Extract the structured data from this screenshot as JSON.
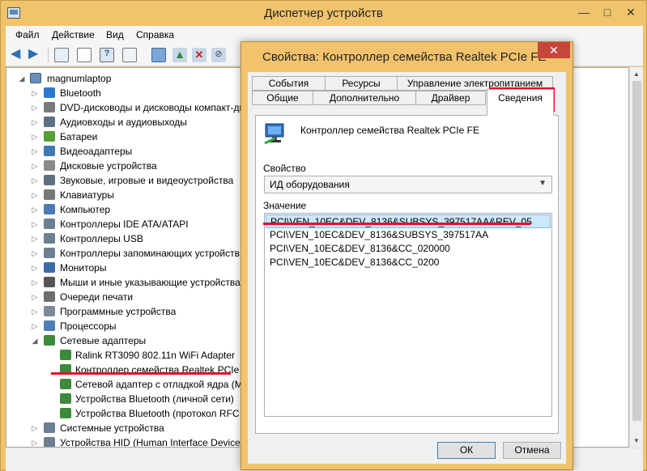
{
  "main": {
    "title": "Диспетчер устройств",
    "win_min": "—",
    "win_max": "□",
    "win_close": "✕"
  },
  "menu": [
    "Файл",
    "Действие",
    "Вид",
    "Справка"
  ],
  "tree": {
    "root": "magnumlaptop",
    "items": [
      "Bluetooth",
      "DVD-дисководы и дисководы компакт-ди",
      "Аудиовходы и аудиовыходы",
      "Батареи",
      "Видеоадаптеры",
      "Дисковые устройства",
      "Звуковые, игровые и видеоустройства",
      "Клавиатуры",
      "Компьютер",
      "Контроллеры IDE ATA/ATAPI",
      "Контроллеры USB",
      "Контроллеры запоминающих устройств",
      "Мониторы",
      "Мыши и иные указывающие устройства",
      "Очереди печати",
      "Программные устройства",
      "Процессоры",
      "Сетевые адаптеры"
    ],
    "network_children": [
      "Ralink RT3090 802.11n WiFi Adapter",
      "Контроллер семейства Realtek PCIe F",
      "Сетевой адаптер с отладкой ядра (Ма",
      "Устройства Bluetooth (личной сети)",
      "Устройства Bluetooth (протокол RFC"
    ],
    "after": [
      "Системные устройства",
      "Устройства HID (Human Interface Devices)"
    ]
  },
  "dialog": {
    "title": "Свойства: Контроллер семейства Realtek PCIe FE",
    "close": "✕",
    "tabs_top": [
      "События",
      "Ресурсы",
      "Управление электропитанием"
    ],
    "tabs_bottom": [
      "Общие",
      "Дополнительно",
      "Драйвер",
      "Сведения"
    ],
    "device_name": "Контроллер семейства Realtek PCIe FE",
    "property_label": "Свойство",
    "property_value": "ИД оборудования",
    "value_label": "Значение",
    "values": [
      "PCI\\VEN_10EC&DEV_8136&SUBSYS_397517AA&REV_05",
      "PCI\\VEN_10EC&DEV_8136&SUBSYS_397517AA",
      "PCI\\VEN_10EC&DEV_8136&CC_020000",
      "PCI\\VEN_10EC&DEV_8136&CC_0200"
    ],
    "ok": "ОК",
    "cancel": "Отмена"
  },
  "colors": {
    "frame": "#f0c46c",
    "annotation": "#e0102a",
    "selection": "#cce8ff"
  }
}
